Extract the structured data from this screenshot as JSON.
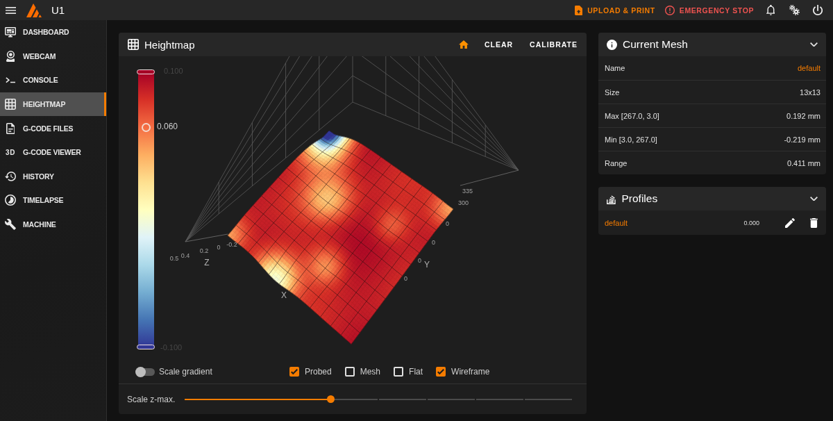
{
  "app_bar": {
    "title": "U1",
    "actions": [
      {
        "label": "UPLOAD & PRINT",
        "kind": "upload"
      },
      {
        "label": "EMERGENCY STOP",
        "kind": "stop"
      }
    ]
  },
  "sidebar": {
    "items": [
      {
        "label": "DASHBOARD",
        "selected": false
      },
      {
        "label": "WEBCAM",
        "selected": false
      },
      {
        "label": "CONSOLE",
        "selected": false
      },
      {
        "label": "HEIGHTMAP",
        "selected": true
      },
      {
        "label": "G-CODE FILES",
        "selected": false
      },
      {
        "label": "G-CODE VIEWER",
        "selected": false,
        "icon_text": "3D"
      },
      {
        "label": "HISTORY",
        "selected": false
      },
      {
        "label": "TIMELAPSE",
        "selected": false
      },
      {
        "label": "MACHINE",
        "selected": false
      }
    ]
  },
  "heightmap": {
    "title": "Heightmap",
    "actions": [
      "CLEAR",
      "CALIBRATE"
    ],
    "color_scale": {
      "max_label": "0.100",
      "min_label": "-0.100",
      "marker_label": "0.060",
      "level": 0.8
    },
    "plot": {
      "axis_labels": {
        "x": "X",
        "y": "Y",
        "z": "Z"
      },
      "z_ticks": [
        "0.5",
        "0.4",
        "0.2",
        "0",
        "-0.2"
      ],
      "y_ticks": [
        "335",
        "300",
        "0",
        "0",
        "0",
        "0"
      ]
    },
    "options": [
      {
        "label": "Scale gradient",
        "kind": "switch",
        "checked": false
      },
      {
        "label": "Probed",
        "kind": "checkbox",
        "checked": true
      },
      {
        "label": "Mesh",
        "kind": "checkbox",
        "checked": false
      },
      {
        "label": "Flat",
        "kind": "checkbox",
        "checked": false
      },
      {
        "label": "Wireframe",
        "kind": "checkbox",
        "checked": true
      }
    ],
    "scale_zmax": {
      "label": "Scale z-max.",
      "level": 0.375
    }
  },
  "current_mesh": {
    "title": "Current Mesh",
    "rows": [
      {
        "label": "Name",
        "value": "default",
        "accent": true
      },
      {
        "label": "Size",
        "value": "13x13",
        "accent": false
      },
      {
        "label": "Max [267.0, 3.0]",
        "value": "0.192 mm",
        "accent": false
      },
      {
        "label": "Min [3.0, 267.0]",
        "value": "-0.219 mm",
        "accent": false
      },
      {
        "label": "Range",
        "value": "0.411 mm",
        "accent": false
      }
    ]
  },
  "profiles": {
    "title": "Profiles",
    "rows": [
      {
        "name": "default",
        "value": "0.000"
      }
    ]
  }
}
